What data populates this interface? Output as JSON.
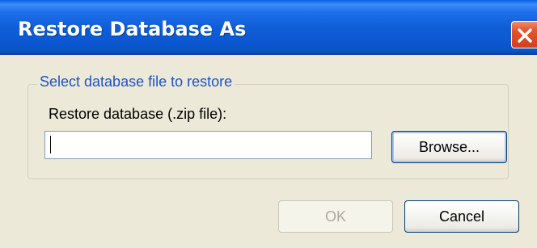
{
  "window": {
    "title": "Restore Database As",
    "close_icon": "close-icon"
  },
  "group": {
    "legend": "Select database file to restore",
    "field_label": "Restore database (.zip file):",
    "input_value": "",
    "browse_label": "Browse..."
  },
  "buttons": {
    "ok_label": "OK",
    "ok_enabled": false,
    "cancel_label": "Cancel"
  },
  "colors": {
    "titlebar": "#0b58d2",
    "legend_text": "#1c52c8",
    "close_button": "#d2401c",
    "dialog_background": "#ece9d8"
  }
}
